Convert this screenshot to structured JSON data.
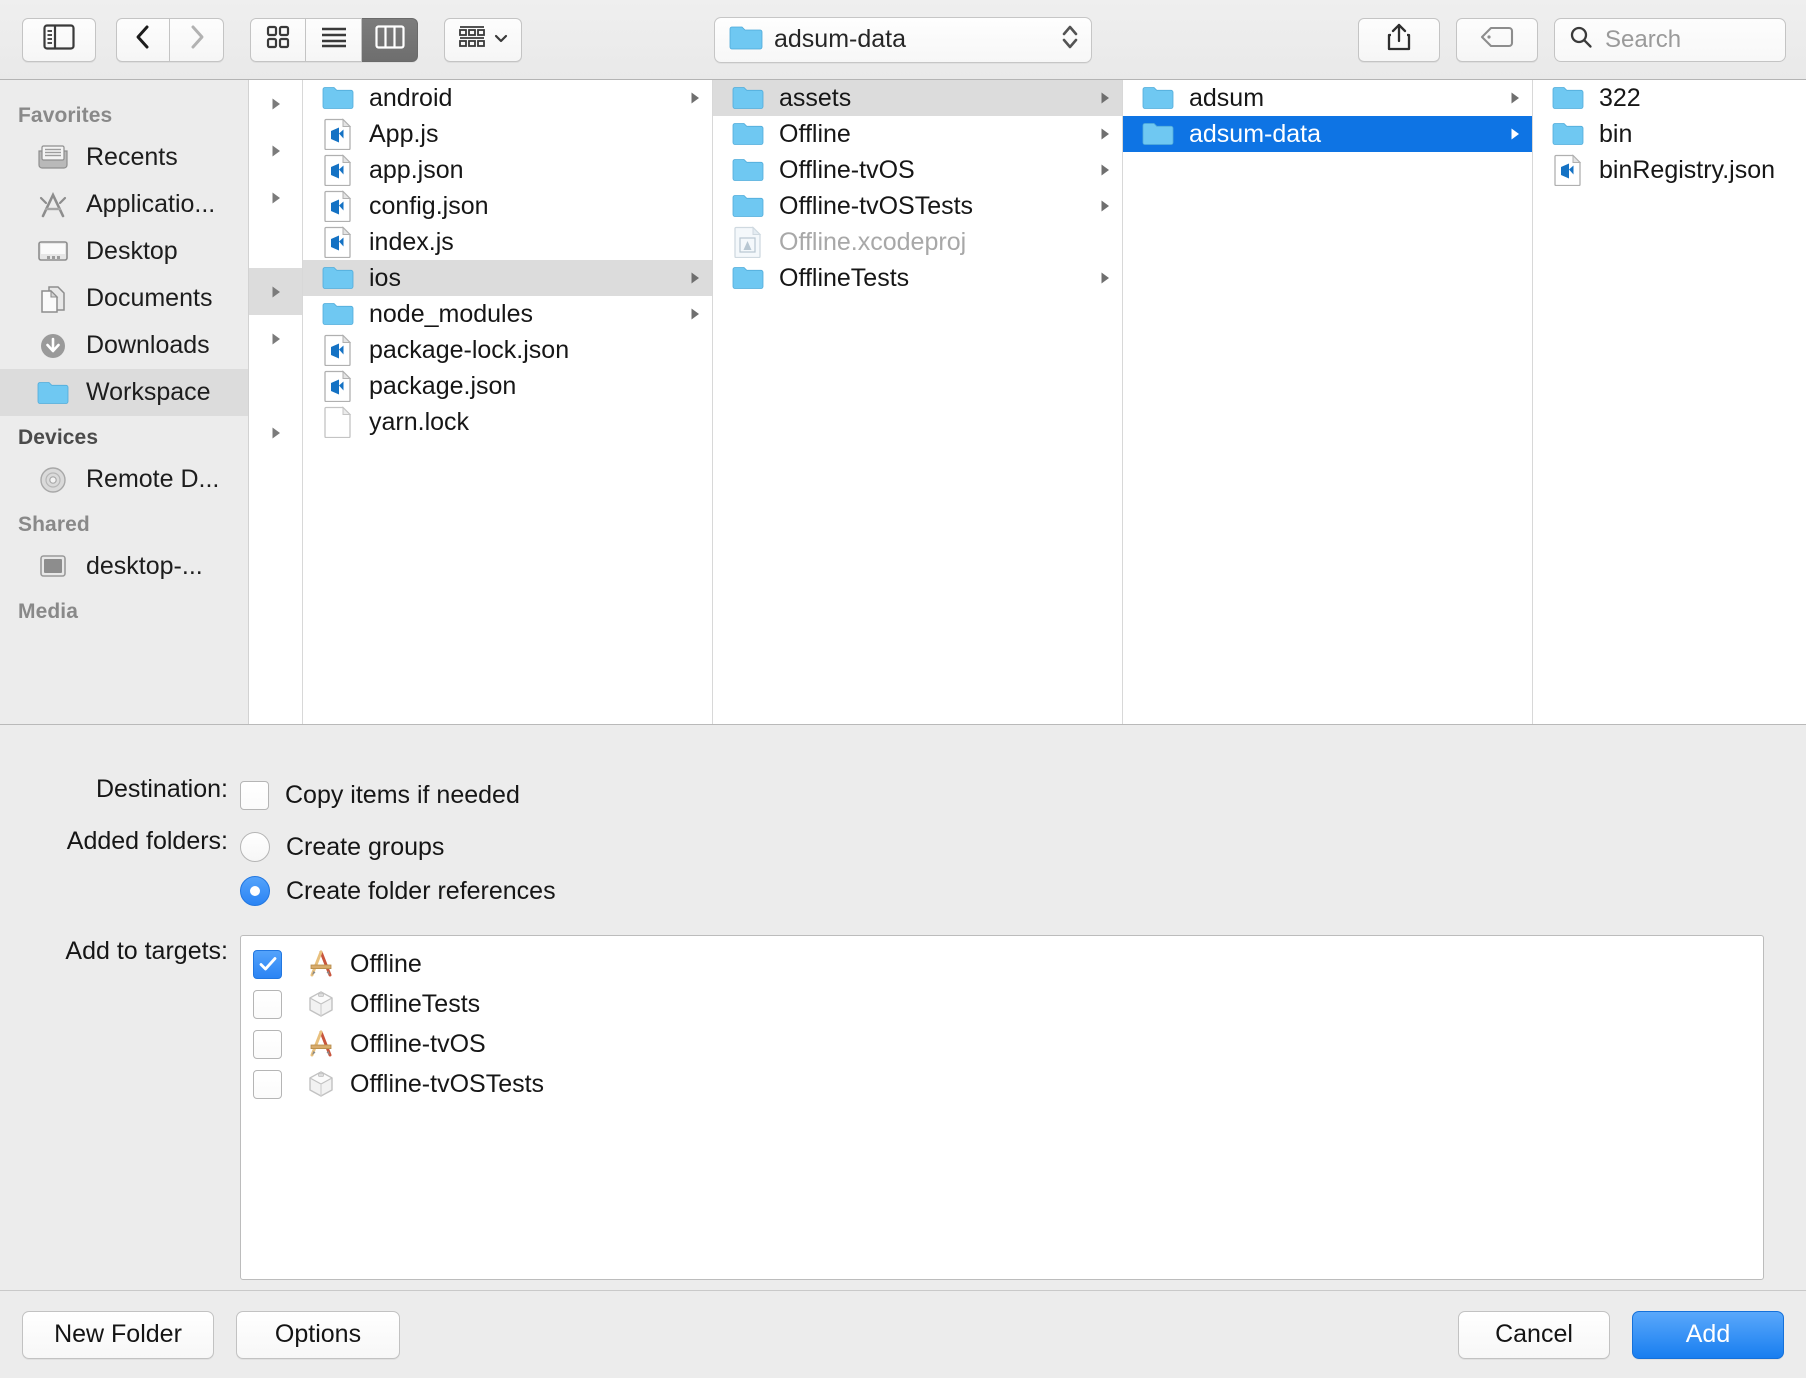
{
  "toolbar": {
    "sidebar_toggle": "sidebar-toggle",
    "back": "back",
    "forward": "forward",
    "view_icon": "icon-view",
    "view_list": "list-view",
    "view_column": "column-view",
    "arrange": "arrange",
    "path_label": "adsum-data",
    "share": "share",
    "tags": "tags",
    "search_placeholder": "Search",
    "search_value": ""
  },
  "sidebar": {
    "sections": [
      {
        "title": "Favorites",
        "style": "light",
        "items": [
          {
            "label": "Recents",
            "icon": "recents-icon",
            "selected": false
          },
          {
            "label": "Applicatio...",
            "icon": "applications-icon",
            "selected": false
          },
          {
            "label": "Desktop",
            "icon": "desktop-icon",
            "selected": false
          },
          {
            "label": "Documents",
            "icon": "documents-icon",
            "selected": false
          },
          {
            "label": "Downloads",
            "icon": "downloads-icon",
            "selected": false
          },
          {
            "label": "Workspace",
            "icon": "folder-icon",
            "selected": true
          }
        ]
      },
      {
        "title": "Devices",
        "style": "dark",
        "items": [
          {
            "label": "Remote D...",
            "icon": "disc-icon",
            "selected": false
          }
        ]
      },
      {
        "title": "Shared",
        "style": "light",
        "items": [
          {
            "label": "desktop-...",
            "icon": "display-icon",
            "selected": false
          }
        ]
      },
      {
        "title": "Media",
        "style": "light",
        "items": []
      }
    ]
  },
  "columns": [
    {
      "name": "column-project-root",
      "items": [
        {
          "label": "android",
          "type": "folder",
          "arrow": true,
          "state": "normal"
        },
        {
          "label": "App.js",
          "type": "code",
          "arrow": false,
          "state": "normal"
        },
        {
          "label": "app.json",
          "type": "code",
          "arrow": false,
          "state": "normal"
        },
        {
          "label": "config.json",
          "type": "code",
          "arrow": false,
          "state": "normal"
        },
        {
          "label": "index.js",
          "type": "code",
          "arrow": false,
          "state": "normal"
        },
        {
          "label": "ios",
          "type": "folder",
          "arrow": true,
          "state": "selected-gray"
        },
        {
          "label": "node_modules",
          "type": "folder",
          "arrow": true,
          "state": "normal"
        },
        {
          "label": "package-lock.json",
          "type": "code",
          "arrow": false,
          "state": "normal"
        },
        {
          "label": "package.json",
          "type": "code",
          "arrow": false,
          "state": "normal"
        },
        {
          "label": "yarn.lock",
          "type": "blank",
          "arrow": false,
          "state": "normal"
        }
      ]
    },
    {
      "name": "column-ios",
      "items": [
        {
          "label": "assets",
          "type": "folder",
          "arrow": true,
          "state": "selected-gray"
        },
        {
          "label": "Offline",
          "type": "folder",
          "arrow": true,
          "state": "normal"
        },
        {
          "label": "Offline-tvOS",
          "type": "folder",
          "arrow": true,
          "state": "normal"
        },
        {
          "label": "Offline-tvOSTests",
          "type": "folder",
          "arrow": true,
          "state": "normal"
        },
        {
          "label": "Offline.xcodeproj",
          "type": "xcodeproj",
          "arrow": false,
          "state": "dim"
        },
        {
          "label": "OfflineTests",
          "type": "folder",
          "arrow": true,
          "state": "normal"
        }
      ]
    },
    {
      "name": "column-assets",
      "items": [
        {
          "label": "adsum",
          "type": "folder",
          "arrow": true,
          "state": "normal"
        },
        {
          "label": "adsum-data",
          "type": "folder",
          "arrow": true,
          "state": "selected-blue"
        }
      ]
    },
    {
      "name": "column-adsum-data",
      "items": [
        {
          "label": "322",
          "type": "folder",
          "arrow": false,
          "state": "normal"
        },
        {
          "label": "bin",
          "type": "folder",
          "arrow": false,
          "state": "normal"
        },
        {
          "label": "binRegistry.json",
          "type": "code",
          "arrow": false,
          "state": "normal"
        }
      ]
    }
  ],
  "options": {
    "destination_label": "Destination:",
    "copy_items_label": "Copy items if needed",
    "copy_items_checked": false,
    "added_folders_label": "Added folders:",
    "create_groups_label": "Create groups",
    "create_groups_checked": false,
    "create_folder_refs_label": "Create folder references",
    "create_folder_refs_checked": true,
    "add_to_targets_label": "Add to targets:",
    "targets": [
      {
        "label": "Offline",
        "icon": "xcode-app-icon",
        "checked": true
      },
      {
        "label": "OfflineTests",
        "icon": "xcode-test-icon",
        "checked": false
      },
      {
        "label": "Offline-tvOS",
        "icon": "xcode-app-icon",
        "checked": false
      },
      {
        "label": "Offline-tvOSTests",
        "icon": "xcode-test-icon",
        "checked": false
      }
    ]
  },
  "footer": {
    "new_folder_label": "New Folder",
    "options_label": "Options",
    "cancel_label": "Cancel",
    "add_label": "Add"
  },
  "colors": {
    "selection_blue": "#0e74e4",
    "control_blue": "#2b84f4",
    "selection_gray": "#dcdcdc",
    "folder_blue": "#6fc8f2",
    "window_bg": "#ececec"
  }
}
